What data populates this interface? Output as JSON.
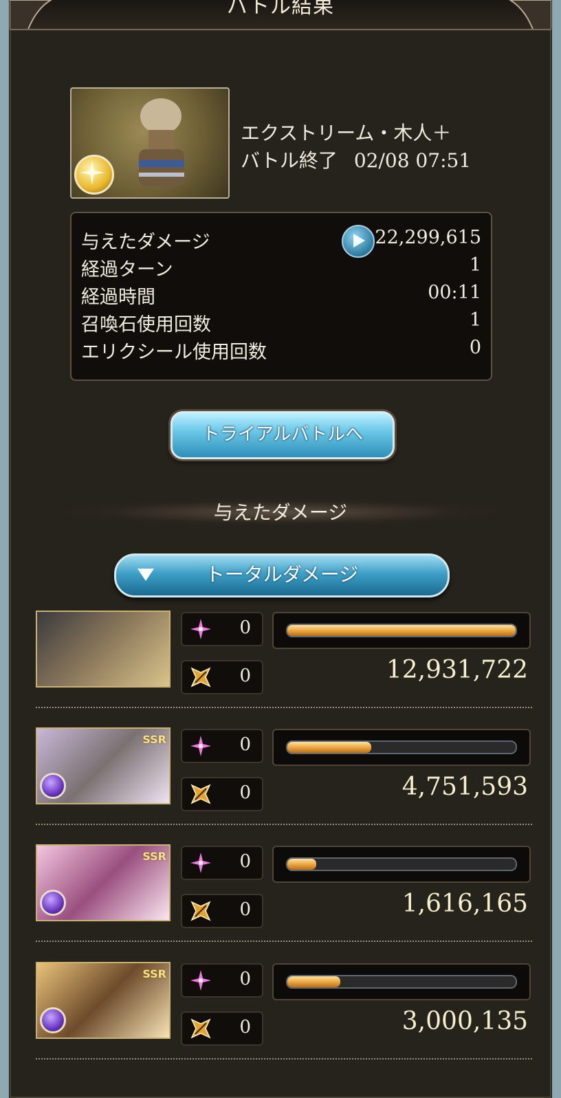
{
  "header": {
    "title": "バトル結果"
  },
  "quest": {
    "name": "エクストリーム・木人＋",
    "end_label": "バトル終了",
    "end_time": "02/08 07:51"
  },
  "stats": {
    "damage": {
      "label": "与えたダメージ",
      "value": "22,299,615"
    },
    "turns": {
      "label": "経過ターン",
      "value": "1"
    },
    "time": {
      "label": "経過時間",
      "value": "00:11"
    },
    "summons": {
      "label": "召喚石使用回数",
      "value": "1"
    },
    "elixirs": {
      "label": "エリクシール使用回数",
      "value": "0"
    }
  },
  "trial_button": {
    "label": "トライアルバトルへ"
  },
  "section": {
    "title": "与えたダメージ"
  },
  "damage_select": {
    "label": "トータルダメージ"
  },
  "members": [
    {
      "skill_count": "0",
      "ca_count": "0",
      "damage": "12,931,722",
      "bar_ratio": 1.0,
      "badge": "",
      "portrait_colors": [
        "#3b3a3e",
        "#8d7a5c",
        "#d9c48a"
      ]
    },
    {
      "skill_count": "0",
      "ca_count": "0",
      "damage": "4,751,593",
      "bar_ratio": 0.367,
      "badge": "SSR",
      "portrait_colors": [
        "#c9b7d8",
        "#7a7172",
        "#f0e3f3"
      ]
    },
    {
      "skill_count": "0",
      "ca_count": "0",
      "damage": "1,616,165",
      "bar_ratio": 0.125,
      "badge": "SSR",
      "portrait_colors": [
        "#f3c6df",
        "#9a4f7e",
        "#fbe6f0"
      ]
    },
    {
      "skill_count": "0",
      "ca_count": "0",
      "damage": "3,000,135",
      "bar_ratio": 0.232,
      "badge": "SSR",
      "portrait_colors": [
        "#e9c27a",
        "#6d4b2b",
        "#f7e3b4"
      ]
    }
  ],
  "icons": {
    "skill": "skill-star-icon",
    "ca": "charge-attack-icon",
    "element": "dark-element-icon",
    "play": "play-icon",
    "dropdown": "chevron-down-icon",
    "quest": "training-dummy-icon"
  }
}
